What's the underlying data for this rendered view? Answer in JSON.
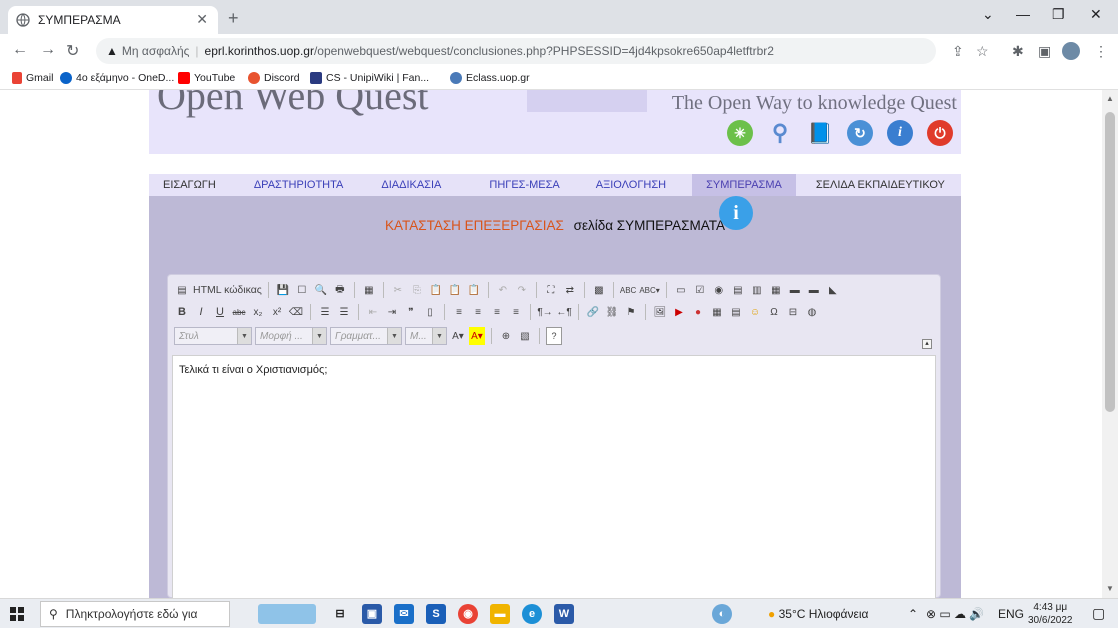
{
  "browser": {
    "tab_title": "ΣΥΜΠΕΡΑΣΜΑ",
    "not_secure_label": "Μη ασφαλής",
    "url_host": "eprl.korinthos.uop.gr",
    "url_path": "/openwebquest/webquest/conclusiones.php?PHPSESSID=4jd4kpsokre650ap4letftrbr2",
    "bookmarks": [
      "Gmail",
      "4ο εξάμηνο - OneD...",
      "YouTube",
      "Discord",
      "CS - UnipiWiki | Fan...",
      "Eclass.uop.gr"
    ]
  },
  "site": {
    "logo_text": "Open Web Quest",
    "tagline": "The Open Way to knowledge Quest",
    "menu": [
      {
        "label": "ΕΙΣΑΓΩΓΗ"
      },
      {
        "label": "ΔΡΑΣΤΗΡΙΟΤΗΤΑ"
      },
      {
        "label": "ΔΙΑΔΙΚΑΣΙΑ"
      },
      {
        "label": "ΠΗΓΕΣ-ΜΕΣΑ"
      },
      {
        "label": "ΑΞΙΟΛΟΓΗΣΗ"
      },
      {
        "label": "ΣΥΜΠΕΡΑΣΜΑ"
      },
      {
        "label": "ΣΕΛΙΔΑ ΕΚΠΑΙΔΕΥΤΙΚΟΥ"
      }
    ],
    "status_label": "ΚΑΤΑΣΤΑΣΗ ΕΠΕΞΕΡΓΑΣΙΑΣ",
    "page_label": "σελίδα ΣΥΜΠΕΡΑΣΜΑΤΑ"
  },
  "editor": {
    "html_code_label": "HTML κώδικας",
    "style_combo": "Στυλ",
    "format_combo": "Μορφή ...",
    "font_combo": "Γραμματ...",
    "size_combo": "Μ...",
    "content": "Τελικά τι είναι ο Χριστιανισμός;"
  },
  "taskbar": {
    "search_placeholder": "Πληκτρολογήστε εδώ για",
    "weather": "35°C Ηλιοφάνεια",
    "language": "ENG",
    "time": "4:43 μμ",
    "date": "30/6/2022"
  },
  "colors": {
    "status_orange": "#d9541a",
    "menu_active": "#4a3fb0",
    "content_bg": "#bdb9d6"
  }
}
